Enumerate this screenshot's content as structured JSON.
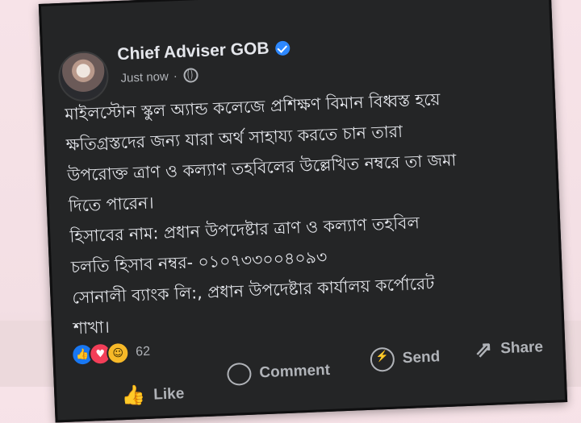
{
  "post": {
    "author": "Chief Adviser GOB",
    "timestamp": "Just now",
    "separator": "·",
    "body_lines": [
      "মাইলস্টোন স্কুল অ্যান্ড কলেজে প্রশিক্ষণ বিমান বিধ্বস্ত হয়ে",
      "ক্ষতিগ্রস্তদের জন্য যারা অর্থ সাহায্য করতে চান তারা",
      "উপরোক্ত ত্রাণ ও কল্যাণ তহবিলের উল্লেখিত নম্বরে তা জমা",
      "দিতে পারেন।",
      "হিসাবের নাম: প্রধান উপদেষ্টার ত্রাণ ও কল্যাণ তহবিল",
      "চলতি হিসাব নম্বর- ০১০৭৩৩০০৪০৯৩",
      "সোনালী ব্যাংক লি:, প্রধান উপদেষ্টার কার্যালয় কর্পোরেট",
      "শাখা।"
    ],
    "reaction_count": "62"
  },
  "actions": {
    "send_label": "Send",
    "share_label": "Share",
    "comment_label": "Comment",
    "like_label": "Like"
  },
  "icons": {
    "more": "more-icon",
    "close": "close-icon",
    "verified": "verified-badge-icon",
    "globe": "globe-icon"
  },
  "colors": {
    "card_bg": "#242526",
    "text": "#e4e6eb",
    "muted": "#b0b3b8",
    "verified": "#2d88ff",
    "like": "#1877f2",
    "love": "#f33e58",
    "haha": "#f7b928"
  }
}
